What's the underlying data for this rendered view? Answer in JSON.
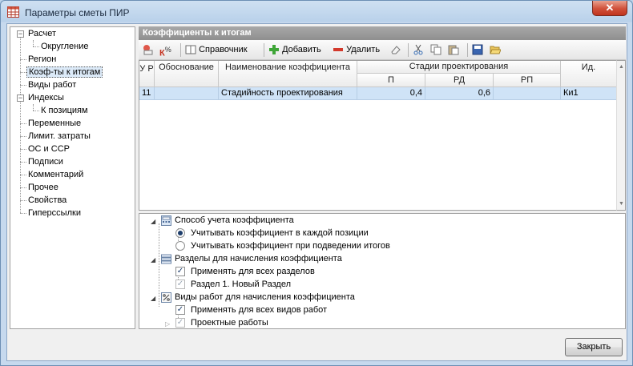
{
  "window": {
    "title": "Параметры сметы ПИР",
    "close_glyph": "✕"
  },
  "nav": {
    "items": [
      {
        "label": "Расчет"
      },
      {
        "label": "Округление"
      },
      {
        "label": "Регион"
      },
      {
        "label": "Коэф-ты к итогам"
      },
      {
        "label": "Виды работ"
      },
      {
        "label": "Индексы"
      },
      {
        "label": "К позициям"
      },
      {
        "label": "Переменные"
      },
      {
        "label": "Лимит. затраты"
      },
      {
        "label": "ОС и ССР"
      },
      {
        "label": "Подписи"
      },
      {
        "label": "Комментарий"
      },
      {
        "label": "Прочее"
      },
      {
        "label": "Свойства"
      },
      {
        "label": "Гиперссылки"
      }
    ]
  },
  "panel": {
    "title": "Коэффициенты к итогам"
  },
  "toolbar": {
    "k_percent": "%",
    "k_letter": "К",
    "reference": "Справочник",
    "add": "Добавить",
    "delete": "Удалить"
  },
  "grid": {
    "headers": {
      "ur": "У Р",
      "basis": "Обоснование",
      "name": "Наименование коэффициента",
      "stages": "Стадии проектирования",
      "p": "П",
      "rd": "РД",
      "rp": "РП",
      "id": "Ид."
    },
    "rows": [
      {
        "ur": "11",
        "basis": "",
        "name": "Стадийность проектирования",
        "p": "0,4",
        "rd": "0,6",
        "rp": "",
        "id": "Ки1"
      }
    ]
  },
  "settings": {
    "method_title": "Способ учета коэффициента",
    "method_option1": "Учитывать коэффициент в каждой позиции",
    "method_option2": "Учитывать коэффициент при подведении итогов",
    "sections_title": "Разделы для начисления коэффициента",
    "sections_all": "Применять для всех разделов",
    "section1": "Раздел 1. Новый Раздел",
    "worktypes_title": "Виды работ для начисления коэффициента",
    "worktypes_all": "Применять для всех видов работ",
    "worktype1": "Проектные работы"
  },
  "footer": {
    "close": "Закрыть"
  }
}
